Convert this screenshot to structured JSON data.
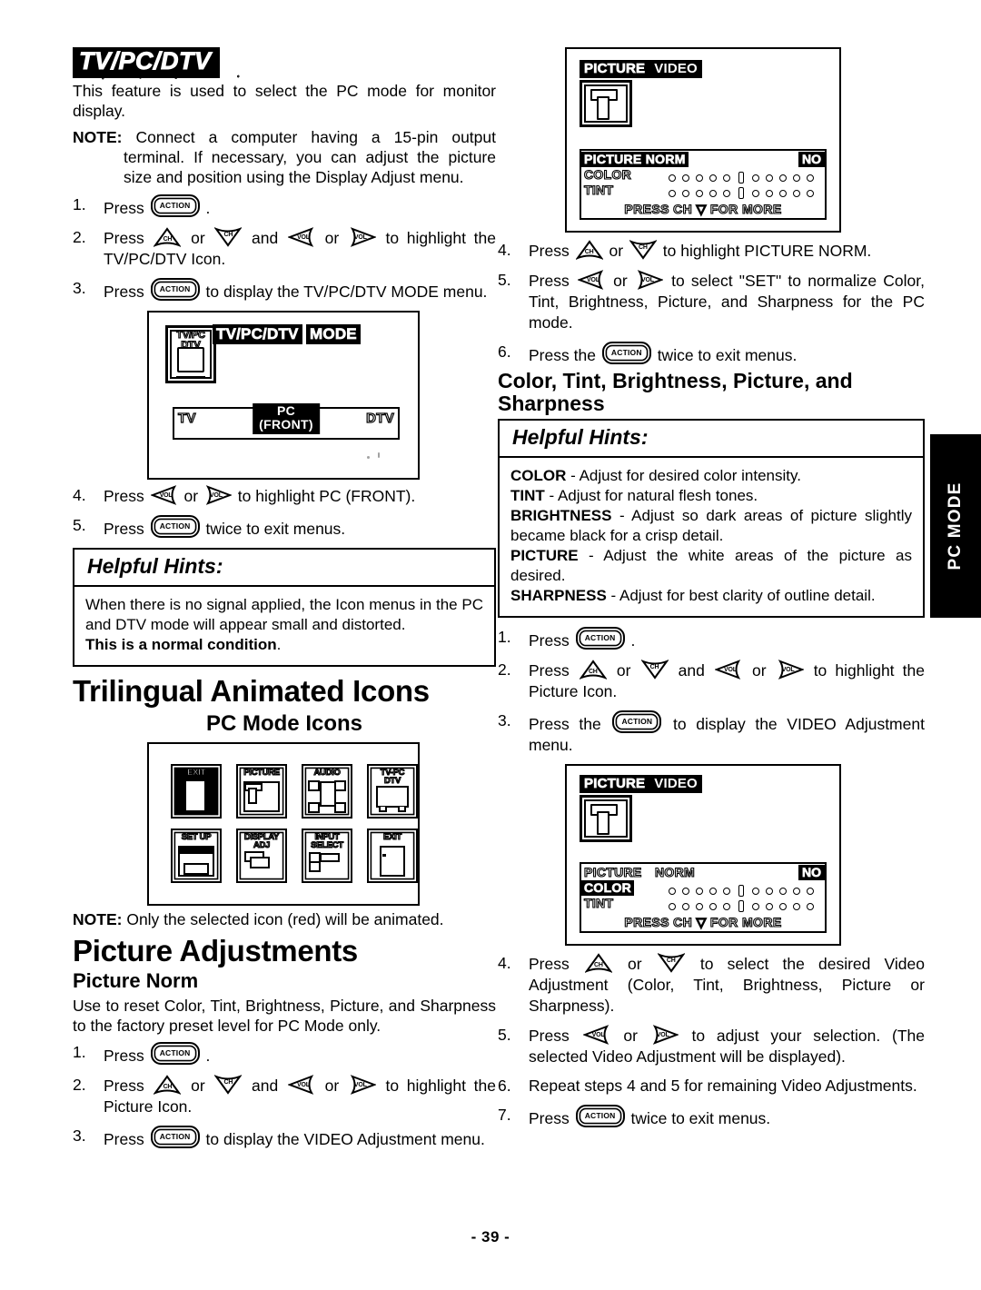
{
  "page": {
    "number": "- 39 -",
    "side_tab": "PC MODE"
  },
  "left": {
    "banner_title": "TV/PC/DTV",
    "intro": "This feature is used to select the PC mode for monitor display.",
    "note": {
      "label": "NOTE",
      "text": "Connect a computer having a 15-pin output terminal. If necessary, you can adjust the picture size and position using the Display Adjust menu."
    },
    "steps_a": [
      {
        "num": "1.",
        "pre": "Press",
        "keys": [
          "ACTION"
        ],
        "post": "."
      },
      {
        "num": "2.",
        "pre": "Press",
        "keys": [
          "CH-UP",
          "CH-DOWN",
          "VOL-LEFT",
          "VOL-RIGHT"
        ],
        "post": "to highlight the TV/PC/DTV Icon."
      },
      {
        "num": "3.",
        "pre": "Press",
        "keys": [
          "ACTION"
        ],
        "post": "to display the TV/PC/DTV MODE menu."
      }
    ],
    "mode_screen": {
      "icon_label_1": "TV/PC",
      "icon_label_2": "DTV",
      "title_line1": "TV/PC/DTV",
      "title_line2": "MODE",
      "selector_left": "TV",
      "selector_mid_line1": "PC",
      "selector_mid_line2": "(FRONT)",
      "selector_right": "DTV"
    },
    "steps_b": [
      {
        "num": "4.",
        "pre": "Press",
        "keys": [
          "VOL-LEFT",
          "VOL-RIGHT"
        ],
        "post": "to highlight PC (FRONT)."
      },
      {
        "num": "5.",
        "pre": "Press",
        "keys": [
          "ACTION"
        ],
        "post": "twice to exit menus."
      }
    ],
    "hints": {
      "title": "Helpful Hints:",
      "body": "When there is no signal applied, the Icon menus in the PC and DTV mode will appear small and distorted.",
      "bold_tail": "This is a normal condition",
      "tail_period": "."
    },
    "h_trilingual": "Trilingual Animated Icons",
    "h_pc_mode_icons": "PC Mode Icons",
    "icons": [
      {
        "line1": "EXIT",
        "line2": "",
        "art": "exit-selected",
        "selected": true
      },
      {
        "line1": "PICTURE",
        "line2": "",
        "art": "picture",
        "selected": false
      },
      {
        "line1": "AUDIO",
        "line2": "",
        "art": "audio",
        "selected": false
      },
      {
        "line1": "TV-PC",
        "line2": "DTV",
        "art": "tvpcdtv",
        "selected": false
      },
      {
        "line1": "SET UP",
        "line2": "",
        "art": "setup",
        "selected": false
      },
      {
        "line1": "DISPLAY",
        "line2": "ADJ",
        "art": "display-adj",
        "selected": false
      },
      {
        "line1": "INPUT",
        "line2": "SELECT",
        "art": "input-select",
        "selected": false
      },
      {
        "line1": "EXIT",
        "line2": "",
        "art": "exit-door",
        "selected": false
      }
    ],
    "icon_note_label": "NOTE",
    "icon_note_text": "Only the selected icon (red) will be animated.",
    "h_picture_adjustments": "Picture Adjustments",
    "h_picture_norm": "Picture Norm",
    "picture_norm_text": "Use to reset Color, Tint, Brightness, Picture, and Sharpness to the factory preset level for PC Mode only.",
    "steps_c": [
      {
        "num": "1.",
        "pre": "Press",
        "keys": [
          "ACTION"
        ],
        "post": "."
      },
      {
        "num": "2.",
        "pre": "Press",
        "keys": [
          "CH-UP",
          "CH-DOWN",
          "VOL-LEFT",
          "VOL-RIGHT"
        ],
        "post": "to highlight the Picture Icon."
      },
      {
        "num": "3.",
        "pre": "Press",
        "keys": [
          "ACTION"
        ],
        "post": "to display the VIDEO Adjustment menu."
      }
    ]
  },
  "right": {
    "osd_top": {
      "tab_picture": "PICTURE",
      "tab_video": "VIDEO",
      "panel_label": "PICTURE NORM",
      "panel_value": "NO",
      "row_color": "COLOR",
      "row_tint": "TINT",
      "footer": "PRESS CH ▽ FOR MORE",
      "highlighted_row": "PICTURE NORM"
    },
    "steps_a": [
      {
        "num": "4.",
        "pre": "Press",
        "keys": [
          "CH-UP",
          "CH-DOWN"
        ],
        "post": "to highlight PICTURE NORM."
      },
      {
        "num": "5.",
        "pre": "Press",
        "keys": [
          "VOL-LEFT",
          "VOL-RIGHT"
        ],
        "post": "to select \"SET\" to normalize Color, Tint, Brightness, Picture, and Sharpness for the PC mode."
      },
      {
        "num": "6.",
        "pre": "Press the",
        "keys": [
          "ACTION"
        ],
        "post": "twice to exit menus."
      }
    ],
    "h_color_tint": "Color, Tint, Brightness, Picture, and Sharpness",
    "hints": {
      "title": "Helpful Hints:",
      "items": [
        {
          "term": "COLOR",
          "dash": " - ",
          "def": "Adjust for desired color intensity."
        },
        {
          "term": "TINT",
          "dash": " - ",
          "def": "Adjust for natural flesh tones."
        },
        {
          "term": "BRIGHTNESS",
          "dash": " - ",
          "def": "Adjust so dark areas of picture slightly became black for a crisp detail."
        },
        {
          "term": "PICTURE",
          "dash": " - ",
          "def": "Adjust the white areas of the picture as desired."
        },
        {
          "term": "SHARPNESS",
          "dash": " - ",
          "def": "Adjust for best clarity of outline detail."
        }
      ]
    },
    "steps_b": [
      {
        "num": "1.",
        "pre": "Press",
        "keys": [
          "ACTION"
        ],
        "post": "."
      },
      {
        "num": "2.",
        "pre": "Press",
        "keys": [
          "CH-UP",
          "CH-DOWN",
          "VOL-LEFT",
          "VOL-RIGHT"
        ],
        "post": "to highlight the Picture Icon."
      },
      {
        "num": "3.",
        "pre": "Press the",
        "keys": [
          "ACTION"
        ],
        "post": "to display the VIDEO Adjustment menu."
      }
    ],
    "osd_bottom": {
      "tab_picture": "PICTURE",
      "tab_video": "VIDEO",
      "panel_label": "PICTURE",
      "panel_label2": "NORM",
      "panel_value": "NO",
      "row_color": "COLOR",
      "row_tint": "TINT",
      "footer": "PRESS CH ▽ FOR MORE",
      "highlighted_row": "COLOR"
    },
    "steps_c": [
      {
        "num": "4.",
        "pre": "Press",
        "keys": [
          "CH-UP",
          "CH-DOWN"
        ],
        "post": "to select the desired Video Adjustment (Color, Tint, Brightness, Picture or Sharpness)."
      },
      {
        "num": "5.",
        "pre": "Press",
        "keys": [
          "VOL-LEFT",
          "VOL-RIGHT"
        ],
        "post": "to adjust your selection. (The selected Video Adjustment will be displayed)."
      },
      {
        "num": "6.",
        "pre": "",
        "keys": [],
        "post": "Repeat steps 4 and 5 for remaining Video Adjustments."
      },
      {
        "num": "7.",
        "pre": "Press",
        "keys": [
          "ACTION"
        ],
        "post": "twice to exit menus."
      }
    ]
  },
  "key_labels": {
    "ACTION": "ACTION",
    "CH-UP": "CH",
    "CH-DOWN": "CH",
    "VOL-LEFT": "VOL",
    "VOL-RIGHT": "VOL"
  }
}
